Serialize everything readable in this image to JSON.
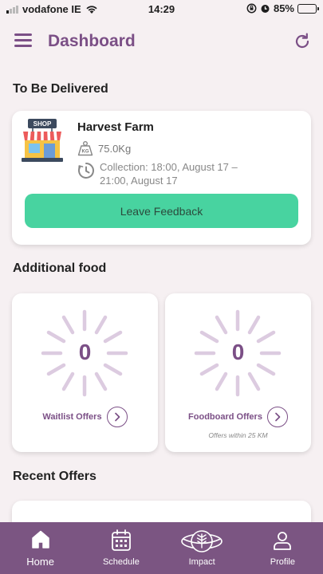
{
  "status_bar": {
    "carrier": "vodafone IE",
    "time": "14:29",
    "battery": "85%"
  },
  "header": {
    "title": "Dashboard"
  },
  "sections": {
    "to_be_delivered": "To Be Delivered",
    "additional_food": "Additional food",
    "recent_offers": "Recent Offers"
  },
  "delivery": {
    "farm_name": "Harvest Farm",
    "weight": "75.0Kg",
    "collection": "Collection: 18:00, August 17 – 21:00, August 17",
    "feedback_label": "Leave Feedback",
    "shop_sign": "SHOP",
    "weight_icon_text": "KG"
  },
  "offers": {
    "waitlist": {
      "count": "0",
      "label": "Waitlist Offers"
    },
    "foodbank": {
      "count": "0",
      "label": "Foodboard Offers",
      "sub": "Offers within 25 KM"
    }
  },
  "nav": {
    "home": "Home",
    "schedule": "Schedule",
    "impact": "Impact",
    "profile": "Profile"
  },
  "colors": {
    "accent": "#7b4f86",
    "button": "#48d3a0",
    "nav_bg": "#7b5582",
    "background": "#f6f0f2"
  }
}
